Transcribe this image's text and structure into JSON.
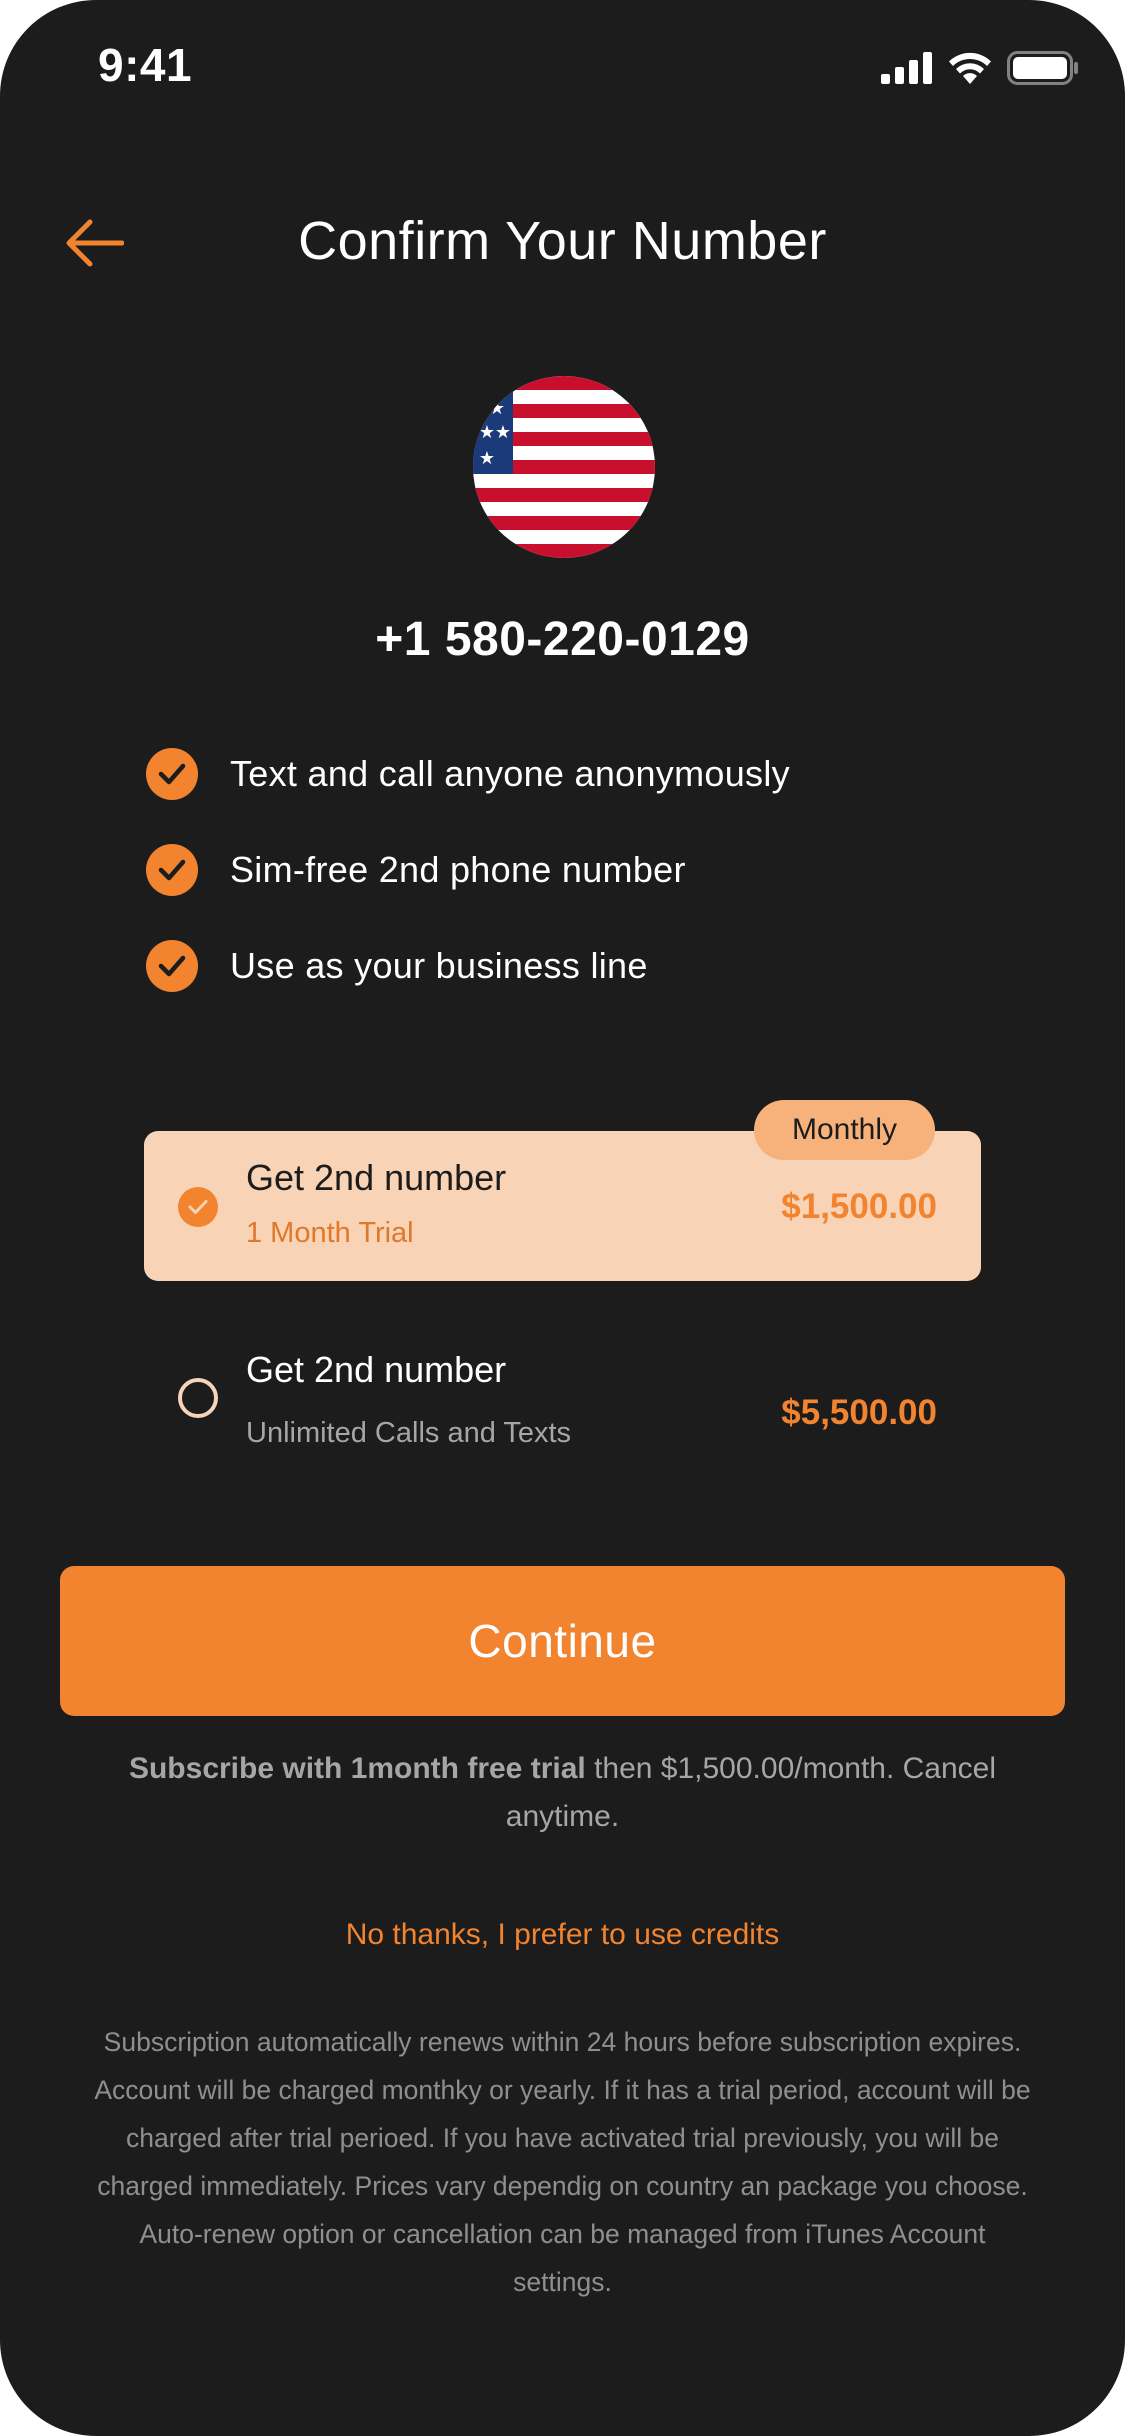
{
  "status_bar": {
    "time": "9:41"
  },
  "header": {
    "title": "Confirm Your Number",
    "back_icon": "arrow-left-icon"
  },
  "number": {
    "country_flag": "us-flag-icon",
    "value": "+1 580-220-0129"
  },
  "features": [
    {
      "text": "Text and call anyone anonymously"
    },
    {
      "text": "Sim-free 2nd phone number"
    },
    {
      "text": "Use as your business line"
    }
  ],
  "plans": [
    {
      "title": "Get 2nd number",
      "subtitle": "1 Month Trial",
      "price": "$1,500.00",
      "badge": "Monthly",
      "selected": true
    },
    {
      "title": "Get 2nd number",
      "subtitle": "Unlimited Calls and Texts",
      "price": "$5,500.00",
      "selected": false
    }
  ],
  "continue_label": "Continue",
  "subscribe_note": {
    "bold": "Subscribe with 1month free trial",
    "rest": " then $1,500.00/month. Cancel anytime."
  },
  "no_thanks_label": "No thanks, I prefer to use credits",
  "legal_text": "Subscription automatically renews within 24 hours before subscription expires. Account will be charged monthky or yearly. If it has a trial period, account will be charged after trial perioed. If you have activated trial previously, you will be charged immediately. Prices vary dependig on country an package you choose. Auto-renew option or cancellation can be managed from iTunes Account settings.",
  "colors": {
    "background": "#1c1c1c",
    "accent": "#f2832f",
    "selected_plan_bg": "#f9d3b5",
    "badge_bg": "#f7b17a",
    "muted_text": "#a6a6a6"
  }
}
